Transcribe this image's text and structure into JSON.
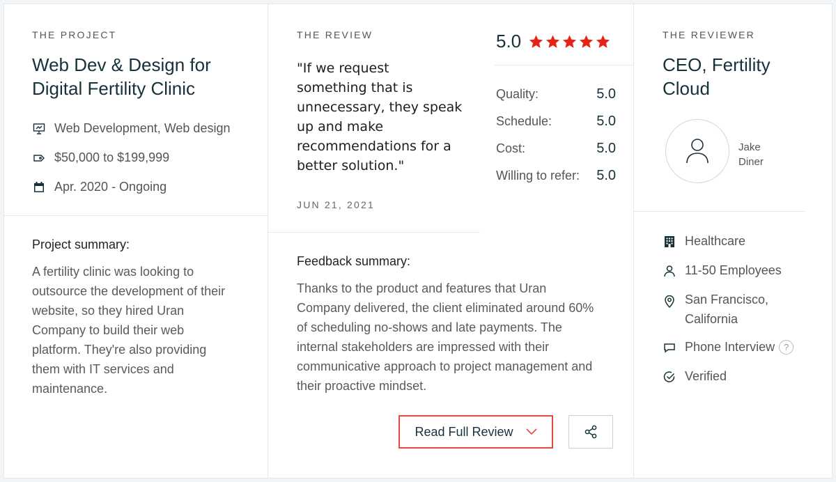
{
  "project": {
    "section_label": "THE PROJECT",
    "title_line1": "Web Dev & Design for",
    "title_line2": "Digital Fertility Clinic",
    "services": "Web Development, Web design",
    "budget": "$50,000 to $199,999",
    "dates": "Apr. 2020 - Ongoing",
    "summary_heading": "Project summary:",
    "summary_lines": [
      "A fertility clinic was looking to",
      "outsource the development of their",
      "website, so they hired Uran",
      "Company to build their web",
      "platform. They're also providing",
      "them with IT services and",
      "maintenance."
    ]
  },
  "review": {
    "section_label": "THE REVIEW",
    "quote_lines": [
      "\"If we request",
      "something that is",
      "unnecessary, they speak",
      "up and make",
      "recommendations for a",
      "better solution.\""
    ],
    "date": "JUN 21, 2021",
    "overall_score": "5.0",
    "stars": 5,
    "star_color": "#e62415",
    "ratings": [
      {
        "label": "Quality:",
        "value": "5.0"
      },
      {
        "label": "Schedule:",
        "value": "5.0"
      },
      {
        "label": "Cost:",
        "value": "5.0"
      },
      {
        "label": "Willing to refer:",
        "value": "5.0"
      }
    ],
    "feedback_heading": "Feedback summary:",
    "feedback_lines": [
      "Thanks to the product and features that Uran",
      "Company delivered, the client eliminated around 60%",
      "of scheduling no-shows and late payments. The",
      "internal stakeholders are impressed with their",
      "communicative approach to project management and",
      "their proactive mindset."
    ],
    "read_full_label": "Read Full Review",
    "accent_color": "#e24a3b"
  },
  "reviewer": {
    "section_label": "THE REVIEWER",
    "title_line1": "CEO, Fertility",
    "title_line2": "Cloud",
    "name_line1": "Jake",
    "name_line2": "Diner",
    "industry": "Healthcare",
    "employees": "11-50 Employees",
    "location_line1": "San Francisco,",
    "location_line2": "California",
    "interview": "Phone Interview",
    "help_glyph": "?",
    "verified": "Verified"
  }
}
